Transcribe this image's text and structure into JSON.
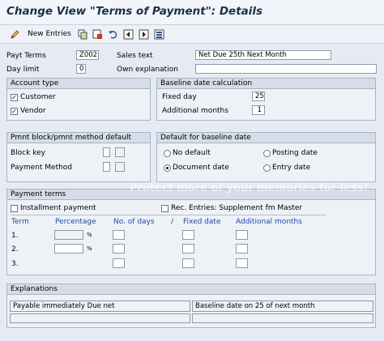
{
  "window": {
    "title": "Change View \"Terms of Payment\": Details"
  },
  "toolbar": {
    "new_entries_label": "New Entries",
    "icons": [
      "pencil-icon",
      "copy-icon",
      "delete-icon",
      "undo-icon",
      "prev-icon",
      "next-icon",
      "select-icon"
    ]
  },
  "header": {
    "payt_terms_label": "Payt Terms",
    "payt_terms_value": "Z002",
    "sales_text_label": "Sales text",
    "sales_text_value": "Net Due 25th Next Month",
    "day_limit_label": "Day limit",
    "day_limit_value": "0",
    "own_explanation_label": "Own explanation",
    "own_explanation_value": ""
  },
  "account_type": {
    "title": "Account type",
    "customer_label": "Customer",
    "customer_checked": true,
    "vendor_label": "Vendor",
    "vendor_checked": true
  },
  "baseline_calc": {
    "title": "Baseline date calculation",
    "fixed_day_label": "Fixed day",
    "fixed_day_value": "25",
    "additional_months_label": "Additional months",
    "additional_months_value": "1"
  },
  "pmnt_block": {
    "title": "Pmnt block/pmnt method default",
    "block_key_label": "Block key",
    "payment_method_label": "Payment Method"
  },
  "default_baseline": {
    "title": "Default for baseline date",
    "options": [
      "No default",
      "Posting date",
      "Document date",
      "Entry date"
    ],
    "selected": "Document date"
  },
  "payment_terms": {
    "title": "Payment terms",
    "installment_label": "Installment payment",
    "rec_entries_label": "Rec. Entries: Supplement fm Master",
    "columns": [
      "Term",
      "Percentage",
      "No. of days",
      "/",
      "Fixed date",
      "Additional months"
    ],
    "rows": [
      "1.",
      "2.",
      "3."
    ],
    "pct_unit": "%"
  },
  "explanations": {
    "title": "Explanations",
    "left": "Payable immediately Due net",
    "right": "Baseline date on 25 of next month"
  },
  "watermark": "Protect more of your memories for less!"
}
